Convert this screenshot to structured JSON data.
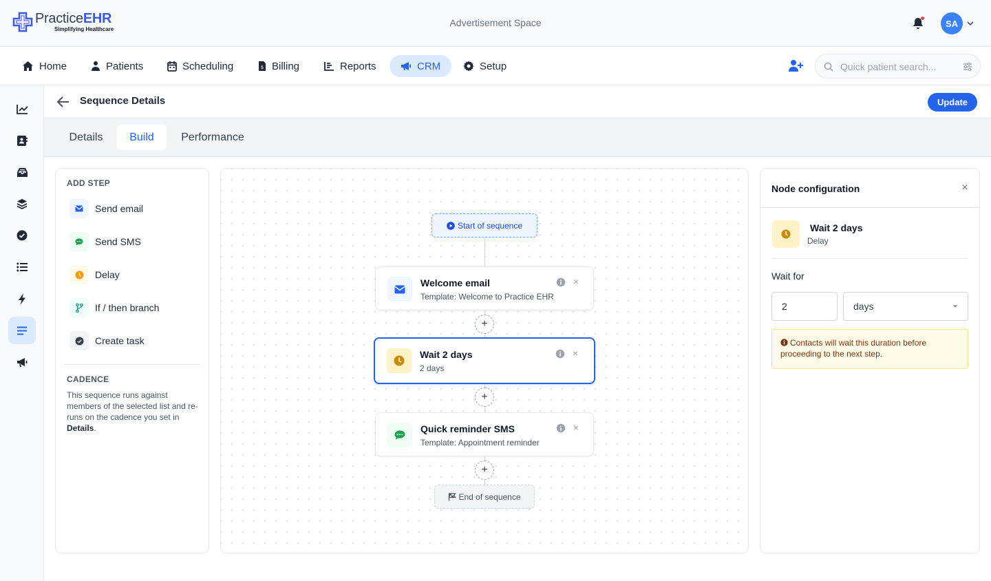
{
  "brand": {
    "name_prefix": "Practice",
    "name_suffix": "EHR",
    "tagline": "Simplifying Healthcare"
  },
  "header": {
    "ad_text": "Advertisement Space",
    "avatar_initials": "SA"
  },
  "nav": {
    "items": [
      {
        "label": "Home",
        "icon": "home-icon"
      },
      {
        "label": "Patients",
        "icon": "patients-icon"
      },
      {
        "label": "Scheduling",
        "icon": "calendar-icon"
      },
      {
        "label": "Billing",
        "icon": "billing-icon"
      },
      {
        "label": "Reports",
        "icon": "reports-icon"
      },
      {
        "label": "CRM",
        "icon": "megaphone-icon",
        "active": true
      },
      {
        "label": "Setup",
        "icon": "gear-icon"
      }
    ],
    "search_placeholder": "Quick patient search..."
  },
  "rail": {
    "icons": [
      "chart-line-icon",
      "contact-book-icon",
      "inbox-icon",
      "layers-icon",
      "check-circle-icon",
      "list-icon",
      "bolt-icon",
      "lines-icon",
      "megaphone-icon"
    ],
    "active_index": 7
  },
  "page": {
    "title": "Sequence Details",
    "update_label": "Update"
  },
  "tabs": [
    {
      "label": "Details"
    },
    {
      "label": "Build",
      "active": true
    },
    {
      "label": "Performance"
    }
  ],
  "steps_panel": {
    "add_step_label": "ADD STEP",
    "items": [
      {
        "label": "Send email",
        "icon": "envelope-icon"
      },
      {
        "label": "Send SMS",
        "icon": "sms-icon"
      },
      {
        "label": "Delay",
        "icon": "clock-icon"
      },
      {
        "label": "If / then branch",
        "icon": "branch-icon"
      },
      {
        "label": "Create task",
        "icon": "task-check-icon"
      }
    ],
    "cadence_label": "CADENCE",
    "cadence_text": "This sequence runs against members of the selected list and re-runs on the cadence you set in",
    "cadence_link": "Details",
    "cadence_end": "."
  },
  "canvas": {
    "start_label": "Start of sequence",
    "end_label": "End of sequence",
    "nodes": [
      {
        "title": "Welcome email",
        "subtitle": "Template: Welcome to Practice EHR",
        "icon": "envelope-icon"
      },
      {
        "title": "Wait 2 days",
        "subtitle": "2 days",
        "icon": "clock-icon",
        "selected": true
      },
      {
        "title": "Quick reminder SMS",
        "subtitle": "Template: Appointment reminder",
        "icon": "sms-icon"
      }
    ],
    "plus_label": "+",
    "close_label": "×"
  },
  "config": {
    "title": "Node configuration",
    "close_label": "×",
    "node_title": "Wait 2 days",
    "node_type": "Delay",
    "wait_label": "Wait for",
    "wait_value": "2",
    "unit_value": "days",
    "hint": "Contacts will wait this duration before proceeding to the next step."
  },
  "colors": {
    "accent": "#2563eb",
    "accent_light": "#dbeafe",
    "warning_bg": "#fefce8",
    "delay_icon": "#ca8a04",
    "sms_icon": "#16a34a"
  }
}
